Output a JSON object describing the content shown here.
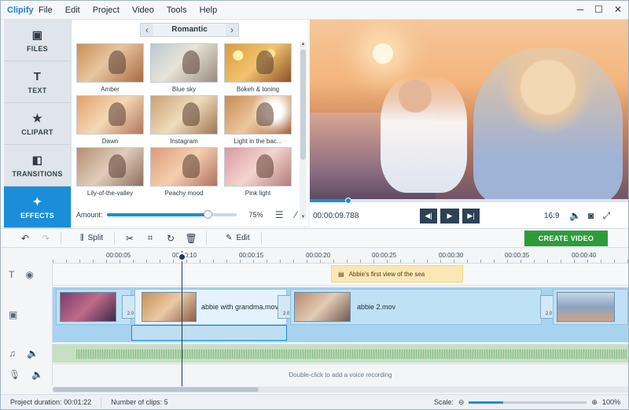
{
  "app": {
    "logo": "Clipify",
    "menu": [
      "File",
      "Edit",
      "Project",
      "Video",
      "Tools",
      "Help"
    ],
    "window_buttons": [
      "─",
      "☐",
      "✕"
    ]
  },
  "tabs": [
    {
      "label": "FILES",
      "icon": "image-icon",
      "glyph": "▣"
    },
    {
      "label": "TEXT",
      "icon": "text-icon",
      "glyph": "T"
    },
    {
      "label": "CLIPART",
      "icon": "star-icon",
      "glyph": "★"
    },
    {
      "label": "TRANSITIONS",
      "icon": "transitions-icon",
      "glyph": "◧"
    },
    {
      "label": "EFFECTS",
      "icon": "effects-wand-icon",
      "glyph": "✦"
    }
  ],
  "effects": {
    "category": "Romantic",
    "items": [
      "Amber",
      "Blue sky",
      "Bokeh & toning",
      "Dawn",
      "Instagram",
      "Light in the bac...",
      "Lily-of-the-valley",
      "Peachy mood",
      "Pink light"
    ],
    "amount_label": "Amount:",
    "amount_value": "75%",
    "amount_fraction": 0.75
  },
  "preview": {
    "timecode": "00:00:09.788",
    "ratio": "16:9",
    "progress_fraction": 0.12
  },
  "toolbar": {
    "split_label": "Split",
    "edit_label": "Edit",
    "create_label": "CREATE VIDEO"
  },
  "timeline": {
    "ruler_labels": [
      "00:00:05",
      "00:00:10",
      "00:00:15",
      "00:00:20",
      "00:00:25",
      "00:00:30",
      "00:00:35",
      "00:00:40"
    ],
    "caption": "Abbie's first view of the sea",
    "clips": [
      "abbie with grandma.mov",
      "abbie 2.mov"
    ],
    "transition_duration": "2.0",
    "voice_hint": "Double-click to add a voice recording"
  },
  "status": {
    "duration_label": "Project duration:",
    "duration_value": "00:01:22",
    "clips_label": "Number of clips:",
    "clips_value": "5",
    "scale_label": "Scale:",
    "scale_value": "100%"
  },
  "colors": {
    "accent": "#1a8ed8",
    "create": "#2e9b3a",
    "caption": "#fbe7b4"
  }
}
